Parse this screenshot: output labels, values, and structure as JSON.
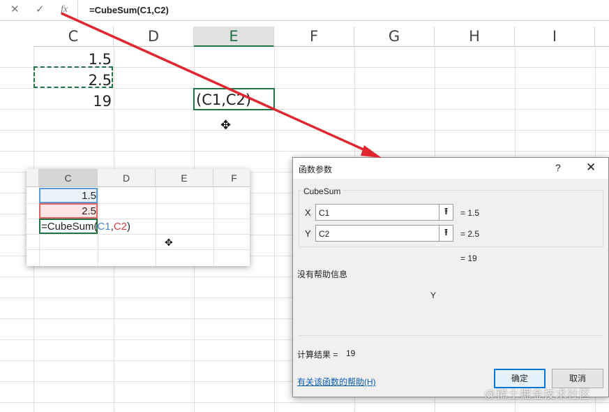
{
  "formula_bar": {
    "cancel_icon": "close-icon",
    "enter_icon": "check-icon",
    "fx_label": "fx",
    "formula": "=CubeSum(C1,C2)"
  },
  "sheet": {
    "columns": [
      "C",
      "D",
      "E",
      "F",
      "G",
      "H",
      "I"
    ],
    "cells": {
      "c1": "1.5",
      "c2": "2.5",
      "c3": "19",
      "e3": "(C1,C2)"
    }
  },
  "inset": {
    "columns": [
      "C",
      "D",
      "E",
      "F"
    ],
    "c1": "1.5",
    "c2": "2.5",
    "formula_prefix": "=CubeSum(",
    "ref1": "C1",
    "comma": ",",
    "ref2": "C2",
    "formula_suffix": ")"
  },
  "dialog": {
    "title": "函数参数",
    "help_glyph": "?",
    "close_glyph": "✕",
    "function_name": "CubeSum",
    "args": [
      {
        "label": "X",
        "value": "C1",
        "result": "=  1.5"
      },
      {
        "label": "Y",
        "value": "C2",
        "result": "=  2.5"
      }
    ],
    "function_result": "=  19",
    "no_help": "没有帮助信息",
    "param_desc": "Y",
    "calc_result_label": "计算结果 =",
    "calc_result_value": "19",
    "help_link": "有关该函数的帮助(H)",
    "ok": "确定",
    "cancel": "取消"
  },
  "watermark": "@稀土掘金技术社区",
  "colors": {
    "excel_green": "#217346",
    "arrow_red": "#e0262f",
    "link_blue": "#0a5cb8"
  }
}
